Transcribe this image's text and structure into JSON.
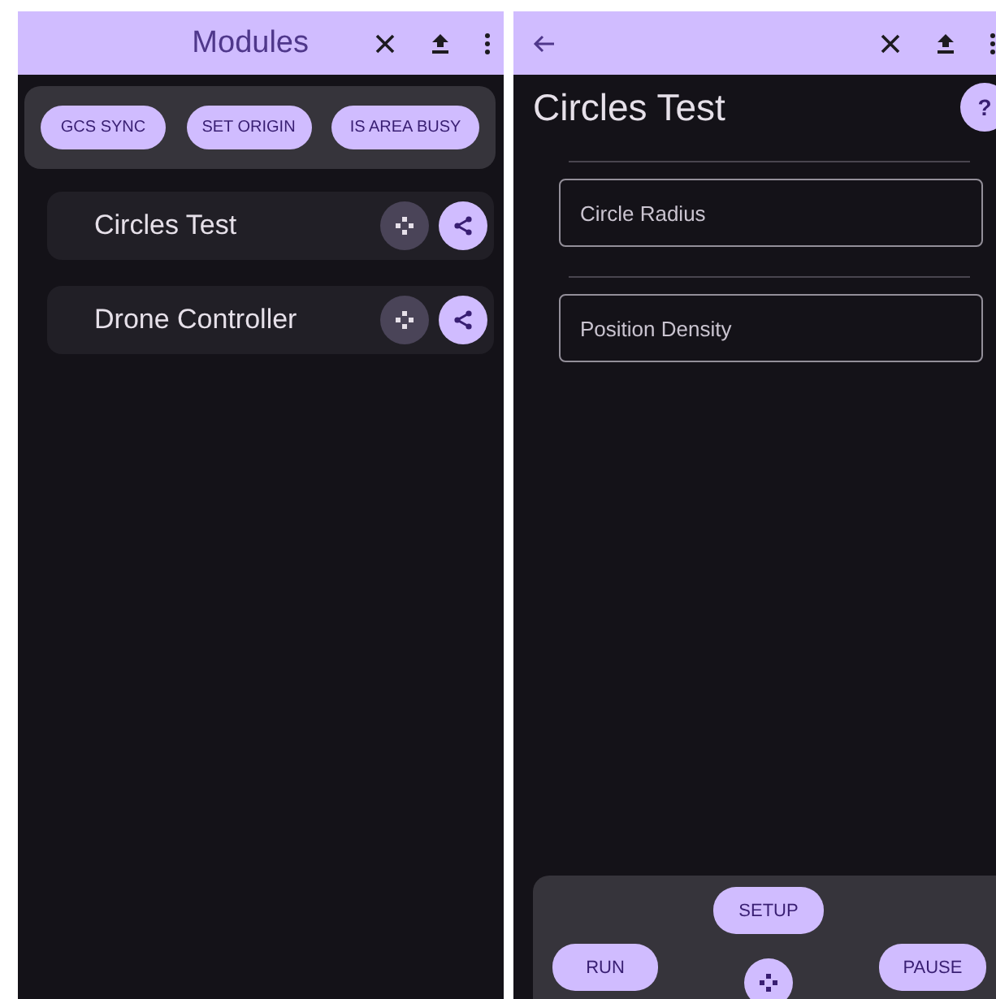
{
  "left_screen": {
    "app_bar": {
      "title": "Modules"
    },
    "actions": [
      "GCS SYNC",
      "SET ORIGIN",
      "IS AREA BUSY"
    ],
    "modules": [
      {
        "name": "Circles Test"
      },
      {
        "name": "Drone Controller"
      }
    ]
  },
  "right_screen": {
    "title": "Circles Test",
    "help": "?",
    "fields": [
      {
        "placeholder": "Circle Radius"
      },
      {
        "placeholder": "Position Density"
      }
    ],
    "controls": {
      "top": "SETUP",
      "left": "RUN",
      "right": "PAUSE"
    }
  }
}
